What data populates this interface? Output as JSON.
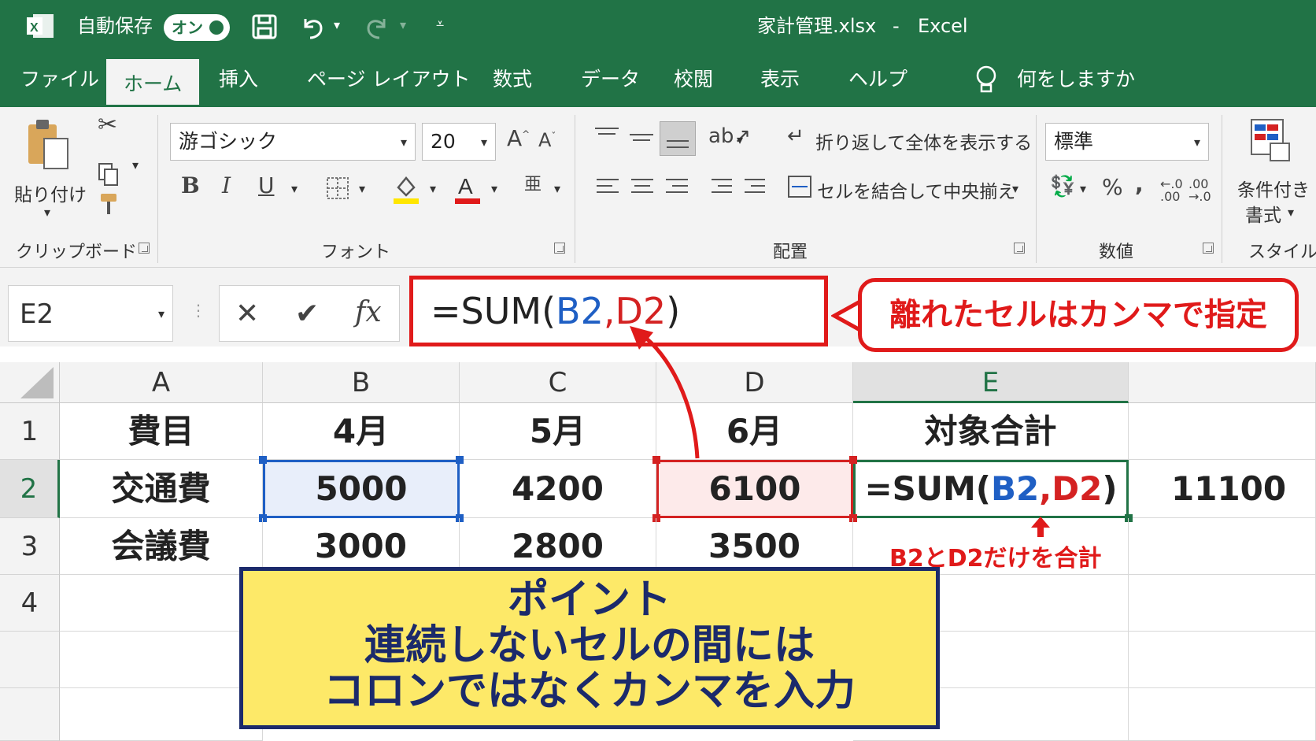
{
  "titlebar": {
    "autosave_label": "自動保存",
    "autosave_state": "オン",
    "doc_title": "家計管理.xlsx",
    "app_name": "Excel",
    "separator": "-"
  },
  "tabs": [
    "ファイル",
    "ホーム",
    "挿入",
    "ページ レイアウト",
    "数式",
    "データ",
    "校閲",
    "表示",
    "ヘルプ"
  ],
  "tell_me": "何をしますか",
  "ribbon": {
    "clipboard": {
      "paste_label": "貼り付け",
      "group_label": "クリップボード"
    },
    "font": {
      "font_name": "游ゴシック",
      "font_size": "20",
      "group_label": "フォント",
      "bold": "B",
      "italic": "I",
      "underline": "U"
    },
    "alignment": {
      "wrap_label": "折り返して全体を表示する",
      "merge_label": "セルを結合して中央揃え",
      "group_label": "配置"
    },
    "number": {
      "format": "標準",
      "percent": "%",
      "comma": ",",
      "group_label": "数値"
    },
    "styles": {
      "cond_line1": "条件付き",
      "cond_line2": "書式",
      "group_label": "スタイル"
    }
  },
  "formula_bar": {
    "name_box": "E2",
    "formula_prefix": "=SUM(",
    "ref1": "B2",
    "comma": ",",
    "ref2": "D2",
    "formula_suffix": ")"
  },
  "callout": "離れたセルはカンマで指定",
  "columns": [
    "A",
    "B",
    "C",
    "D",
    "E"
  ],
  "rows": [
    "1",
    "2",
    "3",
    "4"
  ],
  "cells": {
    "A1": "費目",
    "B1": "4月",
    "C1": "5月",
    "D1": "6月",
    "E1": "対象合計",
    "A2": "交通費",
    "B2": "5000",
    "C2": "4200",
    "D2": "6100",
    "F2": "11100",
    "A3": "会議費",
    "B3": "3000",
    "C3": "2800",
    "D3": "3500"
  },
  "note": "B2とD2だけを合計",
  "point_box": {
    "line1": "ポイント",
    "line2": "連続しないセルの間には",
    "line3": "コロンではなくカンマを入力"
  },
  "colors": {
    "excel_green": "#217346",
    "blue_ref": "#1f5fc4",
    "red_ref": "#d42222",
    "callout_red": "#e01a1a",
    "point_bg": "#fde968",
    "point_border": "#1b2a6b"
  }
}
